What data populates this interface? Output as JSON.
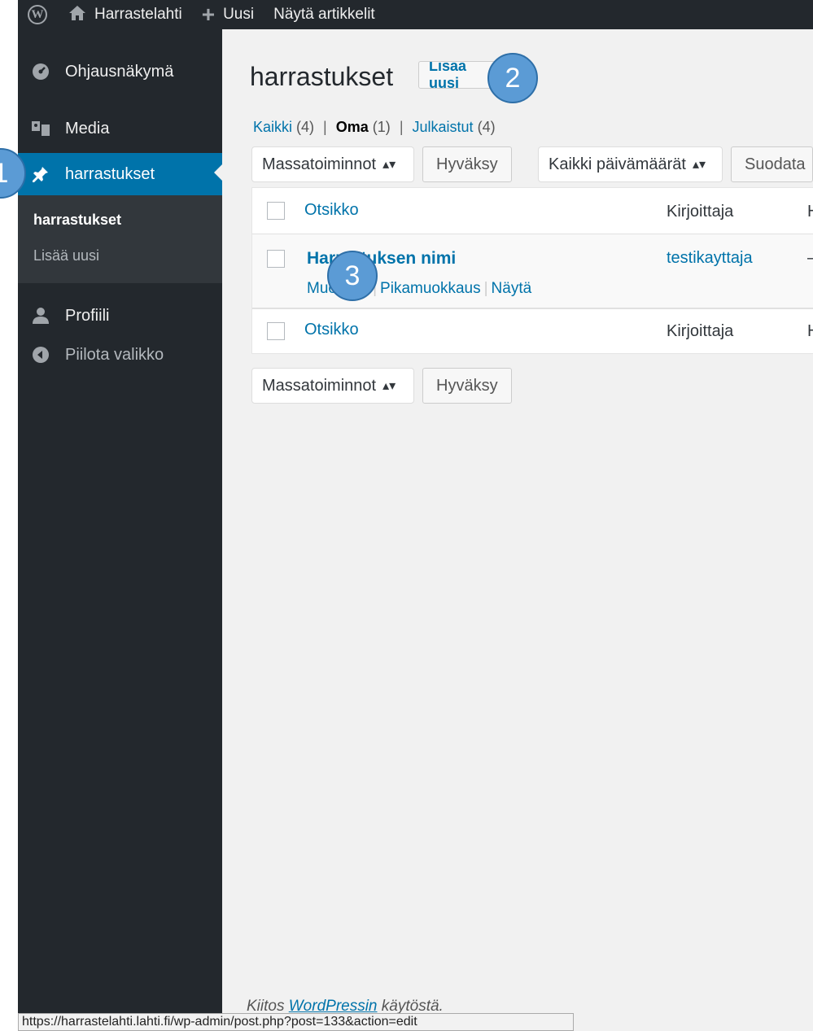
{
  "adminbar": {
    "site_name": "Harrastelahti",
    "new_label": "Uusi",
    "view_posts": "Näytä artikkelit"
  },
  "sidebar": {
    "items": [
      {
        "label": "Ohjausnäkymä",
        "icon": "dashboard-icon"
      },
      {
        "label": "Media",
        "icon": "media-icon"
      },
      {
        "label": "harrastukset",
        "icon": "pin-icon",
        "active": true
      },
      {
        "label": "Profiili",
        "icon": "user-icon"
      },
      {
        "label": "Piilota valikko",
        "icon": "collapse-icon"
      }
    ],
    "submenu": [
      "harrastukset",
      "Lisää uusi"
    ]
  },
  "main": {
    "title": "harrastukset",
    "add_new": "Lisää uusi",
    "filters": {
      "all": "Kaikki",
      "all_count": "(4)",
      "mine": "Oma",
      "mine_count": "(1)",
      "published": "Julkaistut",
      "published_count": "(4)",
      "sep": "|"
    },
    "bulk_actions": "Massatoiminnot",
    "apply": "Hyväksy",
    "all_dates": "Kaikki päivämäärät",
    "filter_button": "Suodata",
    "table": {
      "col_title": "Otsikko",
      "col_author": "Kirjoittaja",
      "col_extra": "H",
      "row": {
        "title": "Harrastuksen nimi",
        "author": "testikayttaja",
        "extra": "–",
        "actions": [
          "Muokkaa",
          "Pikamuokkaus",
          "Näytä"
        ]
      }
    },
    "footer_prefix": "Kiitos ",
    "footer_link": "WordPressin",
    "footer_suffix": " käytöstä."
  },
  "statusbar_url": "https://harrastelahti.lahti.fi/wp-admin/post.php?post=133&action=edit",
  "callouts": [
    "1",
    "2",
    "3"
  ],
  "colors": {
    "accent": "#0073aa",
    "sidebar": "#23282d",
    "callout": "#5b9bd5"
  }
}
